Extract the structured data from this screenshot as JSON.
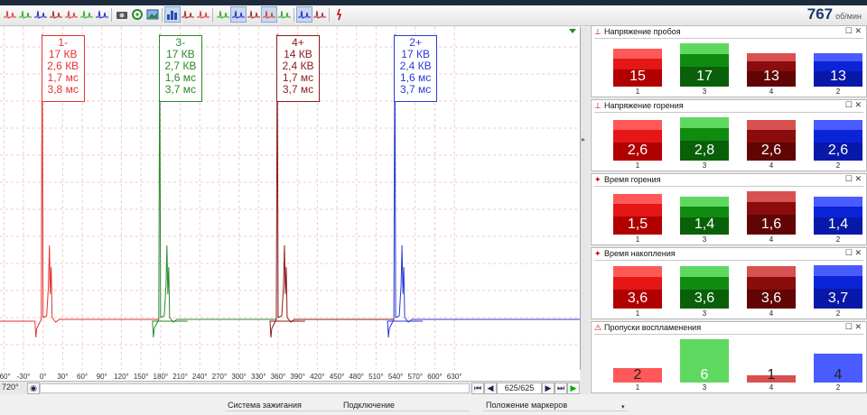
{
  "header": {
    "rpm_value": "767",
    "rpm_unit": "об/мин"
  },
  "toolbar": {
    "icons": [
      "wave-icon",
      "wave-icon",
      "wave-icon",
      "wave-icon",
      "wave-icon",
      "wave-icon",
      "wave-icon",
      "camera-icon",
      "settings-icon",
      "image-icon",
      "bar-chart-icon",
      "wave-icon",
      "wave-icon",
      "wave-icon",
      "wave-icon",
      "wave-icon",
      "wave-icon",
      "wave-icon",
      "wave-icon",
      "wave-icon",
      "spark-icon"
    ]
  },
  "scope": {
    "cylinders": [
      {
        "label": "1-",
        "kv": "17 КВ",
        "burn_kv": "2,6 КВ",
        "burn_ms": "1,7 мс",
        "dwell_ms": "3,8 мс",
        "color": "#e63232"
      },
      {
        "label": "3-",
        "kv": "17 КВ",
        "burn_kv": "2,7 КВ",
        "burn_ms": "1,6 мс",
        "dwell_ms": "3,7 мс",
        "color": "#2a8a2a"
      },
      {
        "label": "4+",
        "kv": "14 КВ",
        "burn_kv": "2,4 КВ",
        "burn_ms": "1,7 мс",
        "dwell_ms": "3,7 мс",
        "color": "#8b1a1a"
      },
      {
        "label": "2+",
        "kv": "17 КВ",
        "burn_kv": "2,4 КВ",
        "burn_ms": "1,6 мс",
        "dwell_ms": "3,7 мс",
        "color": "#2a3ad8"
      }
    ],
    "x_ticks": [
      "-60°",
      "-30°",
      "0°",
      "30°",
      "60°",
      "90°",
      "120°",
      "150°",
      "180°",
      "210°",
      "240°",
      "270°",
      "300°",
      "330°",
      "360°",
      "390°",
      "420°",
      "450°",
      "480°",
      "510°",
      "540°",
      "570°",
      "600°",
      "630°"
    ],
    "range_label": "720°",
    "frame_counter": "625/625"
  },
  "panels": [
    {
      "title": "Напряжение пробоя",
      "labels": [
        "1",
        "3",
        "4",
        "2"
      ],
      "values": [
        "15",
        "17",
        "13",
        "13"
      ],
      "ratios": [
        0.88,
        1.0,
        0.77,
        0.77
      ]
    },
    {
      "title": "Напряжение горения",
      "labels": [
        "1",
        "3",
        "4",
        "2"
      ],
      "values": [
        "2,6",
        "2,8",
        "2,6",
        "2,6"
      ],
      "ratios": [
        0.93,
        1.0,
        0.93,
        0.93
      ]
    },
    {
      "title": "Время горения",
      "labels": [
        "1",
        "3",
        "4",
        "2"
      ],
      "values": [
        "1,5",
        "1,4",
        "1,6",
        "1,4"
      ],
      "ratios": [
        0.94,
        0.88,
        1.0,
        0.88
      ]
    },
    {
      "title": "Время накопления",
      "labels": [
        "1",
        "3",
        "4",
        "2"
      ],
      "values": [
        "3,6",
        "3,6",
        "3,6",
        "3,7"
      ],
      "ratios": [
        0.97,
        0.97,
        0.97,
        1.0
      ]
    },
    {
      "title": "Пропуски воспламенения",
      "labels": [
        "1",
        "3",
        "4",
        "2"
      ],
      "values": [
        "2",
        "6",
        "1",
        "4"
      ],
      "ratios": [
        0.33,
        1.0,
        0.17,
        0.67
      ]
    }
  ],
  "bar_colors": {
    "top": [
      "#ff5858",
      "#5fd85f",
      "#d85050",
      "#4a5cff"
    ],
    "main": [
      "#e51616",
      "#0f8c0f",
      "#8a0c0c",
      "#0c24d8"
    ],
    "dark": [
      "#b00000",
      "#096009",
      "#600404",
      "#0818a8"
    ]
  },
  "bottom": {
    "col1": "Система зажигания",
    "col2": "Подключение",
    "col3": "Положение маркеров"
  }
}
